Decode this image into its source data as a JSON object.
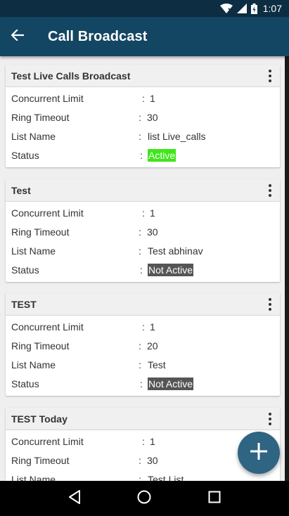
{
  "status_bar": {
    "time": "1:07",
    "icons": [
      "wifi-icon",
      "signal-icon",
      "battery-icon"
    ]
  },
  "app_bar": {
    "title": "Call Broadcast",
    "back_icon": "arrow-back-icon"
  },
  "field_labels": {
    "concurrent_limit": "Concurrent Limit",
    "ring_timeout": "Ring Timeout",
    "list_name": "List Name",
    "status": "Status",
    "separator": ":"
  },
  "broadcasts": [
    {
      "title": "Test Live Calls Broadcast",
      "concurrent_limit": "1",
      "ring_timeout": "30",
      "list_name": "list Live_calls",
      "status": "Active"
    },
    {
      "title": "Test",
      "concurrent_limit": "1",
      "ring_timeout": "30",
      "list_name": "Test abhinav",
      "status": "Not Active"
    },
    {
      "title": "TEST",
      "concurrent_limit": "1",
      "ring_timeout": "20",
      "list_name": "Test",
      "status": "Not Active"
    },
    {
      "title": "TEST Today",
      "concurrent_limit": "1",
      "ring_timeout": "30",
      "list_name": "Test List",
      "status": ""
    }
  ],
  "fab": {
    "icon": "plus-icon"
  },
  "nav_bar": {
    "icons": [
      "back-triangle-icon",
      "home-circle-icon",
      "recents-square-icon"
    ]
  },
  "colors": {
    "app_bar": "#134663",
    "status_bar": "#0c2d42",
    "fab": "#2f6482",
    "active": "#3fe618",
    "inactive": "#555555"
  }
}
